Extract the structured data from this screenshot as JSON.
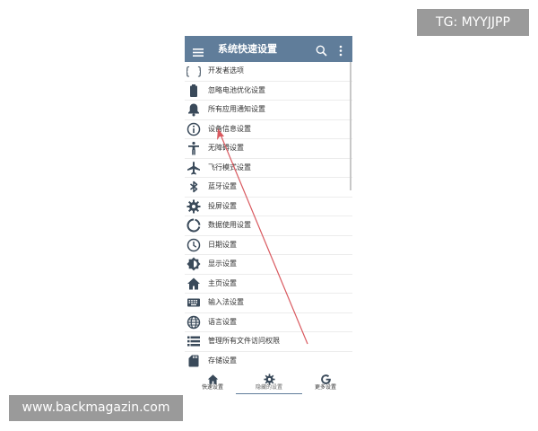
{
  "appbar": {
    "title": "系统快速设置",
    "menu_icon": "hamburger-menu-icon",
    "search_icon": "search-icon",
    "more_icon": "more-vert-icon",
    "color": "#607d9a"
  },
  "list": {
    "items": [
      {
        "label": "开发者选项",
        "icon": "code-braces-icon"
      },
      {
        "label": "忽略电池优化设置",
        "icon": "battery-icon"
      },
      {
        "label": "所有应用通知设置",
        "icon": "bell-icon"
      },
      {
        "label": "设备信息设置",
        "icon": "info-icon"
      },
      {
        "label": "无障碍设置",
        "icon": "accessibility-icon"
      },
      {
        "label": "飞行模式设置",
        "icon": "airplane-icon"
      },
      {
        "label": "蓝牙设置",
        "icon": "bluetooth-icon"
      },
      {
        "label": "投屏设置",
        "icon": "cast-gear-icon"
      },
      {
        "label": "数据使用设置",
        "icon": "data-usage-icon"
      },
      {
        "label": "日期设置",
        "icon": "clock-icon"
      },
      {
        "label": "显示设置",
        "icon": "brightness-icon"
      },
      {
        "label": "主页设置",
        "icon": "home-icon"
      },
      {
        "label": "输入法设置",
        "icon": "keyboard-icon"
      },
      {
        "label": "语言设置",
        "icon": "globe-icon"
      },
      {
        "label": "管理所有文件访问权限",
        "icon": "file-list-icon"
      },
      {
        "label": "存储设置",
        "icon": "sd-card-icon"
      }
    ]
  },
  "bottom_nav": {
    "items": [
      {
        "label": "快速设置",
        "icon": "home-icon"
      },
      {
        "label": "隐藏的设置",
        "icon": "gear-icon"
      },
      {
        "label": "更多设置",
        "icon": "google-g-icon"
      }
    ],
    "active_index": 1
  },
  "watermarks": {
    "tg": "TG: MYYJJPP",
    "url": "www.backmagazin.com"
  },
  "annotation": {
    "color": "#d9595f"
  }
}
